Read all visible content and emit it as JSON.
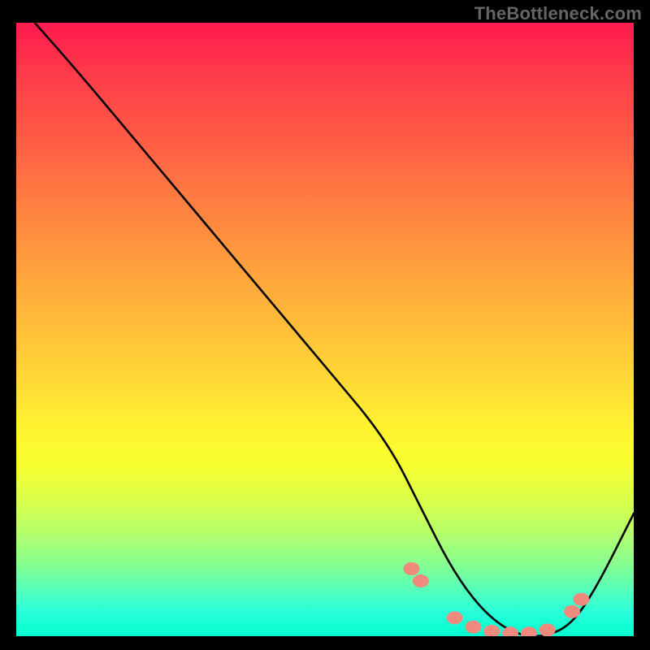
{
  "attribution": "TheBottleneck.com",
  "chart_data": {
    "type": "line",
    "title": "",
    "xlabel": "",
    "ylabel": "",
    "xlim": [
      0,
      100
    ],
    "ylim": [
      0,
      100
    ],
    "series": [
      {
        "name": "curve",
        "x": [
          3,
          10,
          20,
          30,
          40,
          50,
          60,
          66,
          70,
          74,
          78,
          82,
          86,
          90,
          94,
          100
        ],
        "values": [
          100,
          92,
          80,
          68,
          56,
          44,
          32,
          20,
          12,
          6,
          2,
          0,
          0,
          2,
          8,
          20
        ]
      }
    ],
    "markers": {
      "name": "dots",
      "x": [
        64,
        65.5,
        71,
        74,
        77,
        80,
        83,
        86,
        90,
        91.5
      ],
      "values": [
        11,
        9,
        3,
        1.5,
        0.8,
        0.5,
        0.5,
        1,
        4,
        6
      ]
    },
    "gradient_stops": [
      {
        "pos": 0,
        "color": "#ff1a4f"
      },
      {
        "pos": 50,
        "color": "#ffc838"
      },
      {
        "pos": 72,
        "color": "#f7ff2e"
      },
      {
        "pos": 100,
        "color": "#00ffcf"
      }
    ]
  }
}
